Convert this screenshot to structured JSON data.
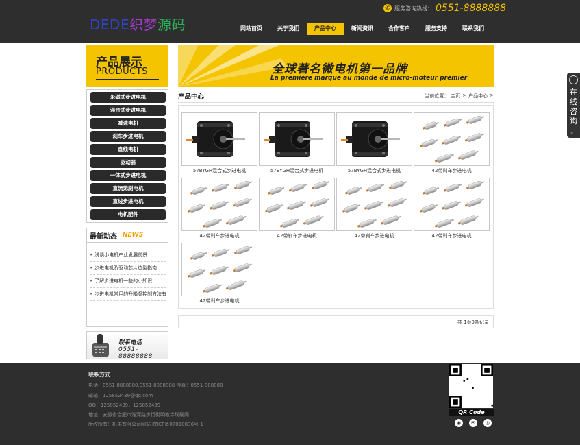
{
  "header": {
    "logo": {
      "part1": "DEDE",
      "part2": "织梦",
      "part3": "源码"
    },
    "hotline_label": "服务咨询热线：",
    "hotline_number": "0551-8888888",
    "nav": [
      {
        "label": "网站首页"
      },
      {
        "label": "关于我们"
      },
      {
        "label": "产品中心"
      },
      {
        "label": "新闻资讯"
      },
      {
        "label": "合作客户"
      },
      {
        "label": "服务支持"
      },
      {
        "label": "联系我们"
      }
    ],
    "active_nav": "产品中心"
  },
  "sidebar": {
    "title_cn": "产品展示",
    "title_en": "PRODUCTS",
    "categories": [
      {
        "label": "永磁式步进电机"
      },
      {
        "label": "混合式步进电机"
      },
      {
        "label": "减速电机"
      },
      {
        "label": "刹车步进电机"
      },
      {
        "label": "直线电机"
      },
      {
        "label": "驱动器"
      },
      {
        "label": "一体式步进电机"
      },
      {
        "label": "直流无刷电机"
      },
      {
        "label": "直线步进电机"
      },
      {
        "label": "电机配件"
      }
    ],
    "news_title_cn": "最新动态",
    "news_title_en": "NEWS",
    "news": [
      {
        "label": "浅谈小电机产业发展前景"
      },
      {
        "label": "步进电机及驱动芯片选型指南"
      },
      {
        "label": "了解步进电机一些的小知识"
      },
      {
        "label": "步进电机常用的升降频控制方法有"
      }
    ],
    "contact_title": "联系电话",
    "contact_number": "0551-88888888"
  },
  "banner": {
    "headline": "全球著名微电机第一品牌",
    "subline": "La première marque au monde de micro-moteur premier"
  },
  "content": {
    "section_title": "产品中心",
    "breadcrumb": [
      "当前位置：",
      "主页",
      ">",
      "产品中心",
      ">"
    ],
    "products": [
      {
        "caption": "57BYGH混合式步进电机",
        "kind": "stepper"
      },
      {
        "caption": "57BYGH混合式步进电机",
        "kind": "stepper"
      },
      {
        "caption": "57BYGH混合式步进电机",
        "kind": "stepper"
      },
      {
        "caption": "42带刹车步进电机",
        "kind": "rods"
      },
      {
        "caption": "42带刹车步进电机",
        "kind": "rods"
      },
      {
        "caption": "42带刹车步进电机",
        "kind": "rods"
      },
      {
        "caption": "42带刹车步进电机",
        "kind": "rods"
      },
      {
        "caption": "42带刹车步进电机",
        "kind": "rods"
      },
      {
        "caption": "42带刹车步进电机",
        "kind": "rods"
      }
    ],
    "pager_text": "共 1页9条记录"
  },
  "footer": {
    "title": "联系方式",
    "lines": [
      "电话：0551-8888880,0551-8888888  传真：0551-888888",
      "邮箱：125852439@qq.com",
      "QQ：125852439，125852439",
      "地址：安徽省合肥市淮河路步行街明教寺蹊蹊阁",
      "版权所有：机电有限公司网站 皖ICP备07010836号-1"
    ],
    "qr_label": "QR Code",
    "social_icons": [
      "qq-icon",
      "mail-icon",
      "weibo-icon"
    ]
  },
  "float_widget": {
    "chars": [
      "在",
      "线",
      "咨",
      "询"
    ],
    "collapse_glyph": "«"
  },
  "colors": {
    "accent": "#f5c400",
    "header_bg": "#2e2e2e",
    "button_bg": "#2a2a2a"
  }
}
